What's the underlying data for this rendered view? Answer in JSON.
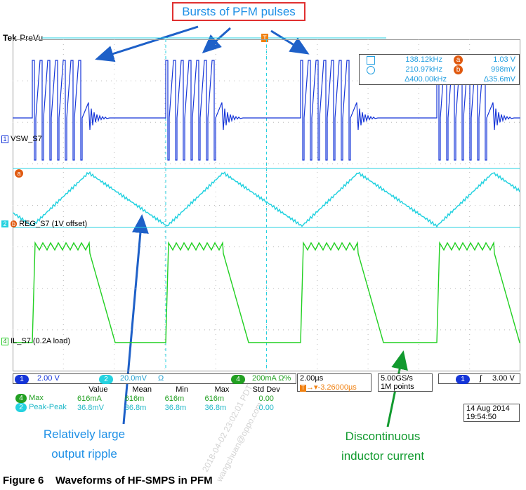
{
  "callout_top": "Bursts of PFM pulses",
  "callout_ripple": [
    "Relatively large",
    "output ripple"
  ],
  "callout_inductor": [
    "Discontinuous",
    "inductor current"
  ],
  "scope": {
    "brand": "Tek",
    "mode": "PreVu",
    "trigger_marker": "T"
  },
  "cursor_readout": {
    "row1_left": "138.12kHz",
    "row1_right": "1.03 V",
    "row2_left": "210.97kHz",
    "row2_right": "998mV",
    "row3_left": "Δ400.00kHz",
    "row3_right": "Δ35.6mV",
    "cursor_a": "a",
    "cursor_b": "b"
  },
  "channels": {
    "ch1_label": "VSW_S7",
    "ch2_label": "REG_S7 (1V offset)",
    "ch4_label": "IL_S7 (0.2A load)",
    "ch1_num": "1",
    "ch2_num": "2",
    "ch4_num": "4",
    "ch1_color": "#1535d8",
    "ch2_color": "#25d2e0",
    "ch4_color": "#22d022"
  },
  "status_bar": {
    "ch1_scale": "2.00 V",
    "ch2_scale": "20.0mV",
    "ch2_suffix": "Ω",
    "ch4_scale": "200mA Ω%",
    "timebase": "2.00µs",
    "trigger_pos": "-3.26000µs",
    "sample_rate": "5.00GS/s",
    "record_length": "1M points",
    "trigger_ch": "1",
    "trigger_slope": "∫",
    "trigger_level": "3.00 V"
  },
  "measurements": {
    "headers": [
      "Value",
      "Mean",
      "Min",
      "Max",
      "Std Dev"
    ],
    "rows": [
      {
        "ch": "4",
        "name": "Max",
        "values": [
          "616mA",
          "616m",
          "616m",
          "616m",
          "0.00"
        ]
      },
      {
        "ch": "2",
        "name": "Peak-Peak",
        "values": [
          "36.8mV",
          "36.8m",
          "36.8m",
          "36.8m",
          "0.00"
        ]
      }
    ]
  },
  "timestamp": {
    "date": "14 Aug 2014",
    "time": "19:54:50"
  },
  "watermark": [
    "2018-04-02 23:02:01 PDT",
    "wangchuan@oppo.com"
  ],
  "caption": "Figure 6    Waveforms of HF-SMPS in PFM"
}
